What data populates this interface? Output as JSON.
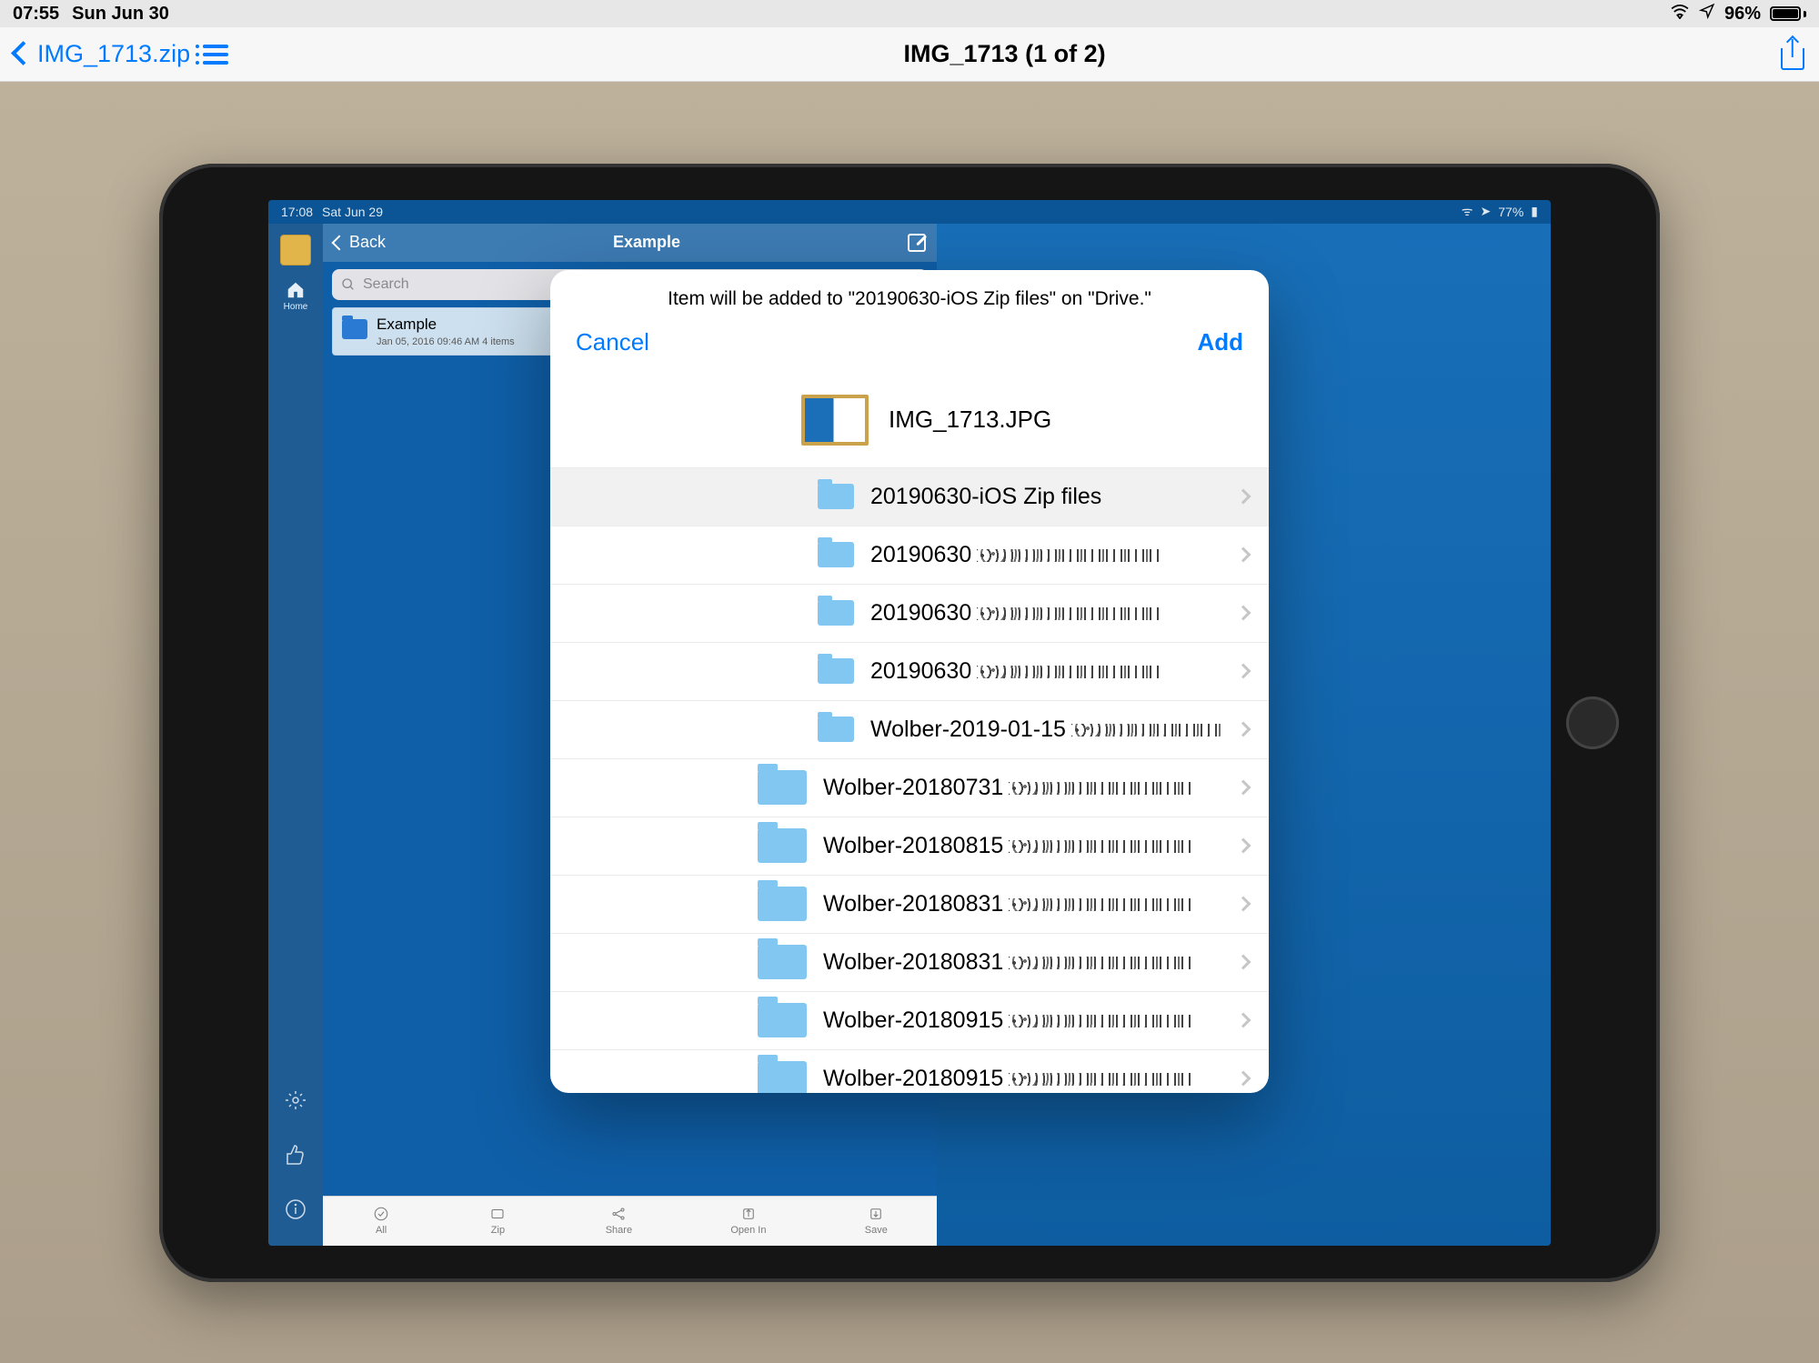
{
  "outer": {
    "status": {
      "time": "07:55",
      "date": "Sun Jun 30",
      "battery_pct": "96%"
    },
    "nav": {
      "back_label": "IMG_1713.zip",
      "title": "IMG_1713 (1 of 2)"
    }
  },
  "inner": {
    "status": {
      "time": "17:08",
      "date": "Sat Jun 29",
      "battery_pct": "77%"
    },
    "sidebar": {
      "home_label": "Home",
      "nav_back": "Back",
      "nav_title": "Example",
      "search_placeholder": "Search",
      "file": {
        "name": "Example",
        "meta": "Jan 05, 2016 09:46 AM  4 items"
      },
      "toolbar": {
        "all": "All",
        "zip": "Zip",
        "share": "Share",
        "openin": "Open In",
        "save": "Save"
      }
    }
  },
  "modal": {
    "message": "Item will be added to \"20190630-iOS Zip files\" on \"Drive.\"",
    "cancel": "Cancel",
    "add": "Add",
    "preview_filename": "IMG_1713.JPG",
    "folders": [
      {
        "label": "20190630-iOS Zip files",
        "indent": "a",
        "selected": true,
        "redacted": false
      },
      {
        "label": "20190630",
        "indent": "a",
        "selected": false,
        "redacted": true
      },
      {
        "label": "20190630",
        "indent": "a",
        "selected": false,
        "redacted": true
      },
      {
        "label": "20190630",
        "indent": "a",
        "selected": false,
        "redacted": true
      },
      {
        "label": "Wolber-2019-01-15",
        "indent": "a",
        "selected": false,
        "redacted": true
      },
      {
        "label": "Wolber-20180731",
        "indent": "b",
        "selected": false,
        "redacted": true
      },
      {
        "label": "Wolber-20180815",
        "indent": "b",
        "selected": false,
        "redacted": true
      },
      {
        "label": "Wolber-20180831",
        "indent": "b",
        "selected": false,
        "redacted": true
      },
      {
        "label": "Wolber-20180831",
        "indent": "b",
        "selected": false,
        "redacted": true
      },
      {
        "label": "Wolber-20180915",
        "indent": "b",
        "selected": false,
        "redacted": true
      },
      {
        "label": "Wolber-20180915",
        "indent": "b",
        "selected": false,
        "redacted": true
      }
    ]
  }
}
